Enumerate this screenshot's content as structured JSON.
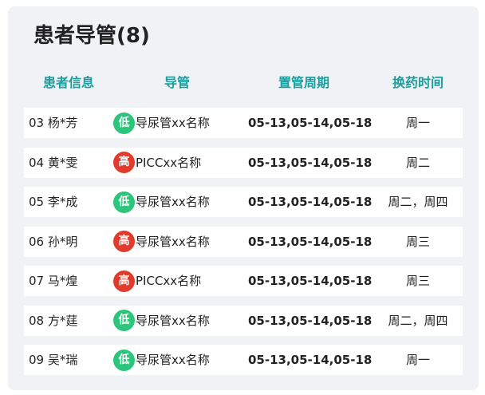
{
  "panel": {
    "title": "患者导管(8)"
  },
  "table": {
    "headers": {
      "patient": "患者信息",
      "catheter": "导管",
      "period": "置管周期",
      "change": "换药时间"
    },
    "rows": [
      {
        "patient": "03 杨*芳",
        "risk": "低",
        "risk_level": "low",
        "catheter": "导尿管xx名称",
        "period": "05-13,05-14,05-18",
        "change": "周一"
      },
      {
        "patient": "04 黄*雯",
        "risk": "高",
        "risk_level": "high",
        "catheter": "PICCxx名称",
        "period": "05-13,05-14,05-18",
        "change": "周二"
      },
      {
        "patient": "05 李*成",
        "risk": "低",
        "risk_level": "low",
        "catheter": "导尿管xx名称",
        "period": "05-13,05-14,05-18",
        "change": "周二，周四"
      },
      {
        "patient": "06 孙*明",
        "risk": "高",
        "risk_level": "high",
        "catheter": "导尿管xx名称",
        "period": "05-13,05-14,05-18",
        "change": "周三"
      },
      {
        "patient": "07 马*煌",
        "risk": "高",
        "risk_level": "high",
        "catheter": "PICCxx名称",
        "period": "05-13,05-14,05-18",
        "change": "周三"
      },
      {
        "patient": "08 方*莛",
        "risk": "低",
        "risk_level": "low",
        "catheter": "导尿管xx名称",
        "period": "05-13,05-14,05-18",
        "change": "周二，周四"
      },
      {
        "patient": "09 吴*瑞",
        "risk": "低",
        "risk_level": "low",
        "catheter": "导尿管xx名称",
        "period": "05-13,05-14,05-18",
        "change": "周一"
      }
    ]
  },
  "colors": {
    "header_text": "#1a9ea0",
    "risk_low": "#2dc47b",
    "risk_high": "#e03c2e",
    "panel_bg": "#f0f2f5"
  }
}
